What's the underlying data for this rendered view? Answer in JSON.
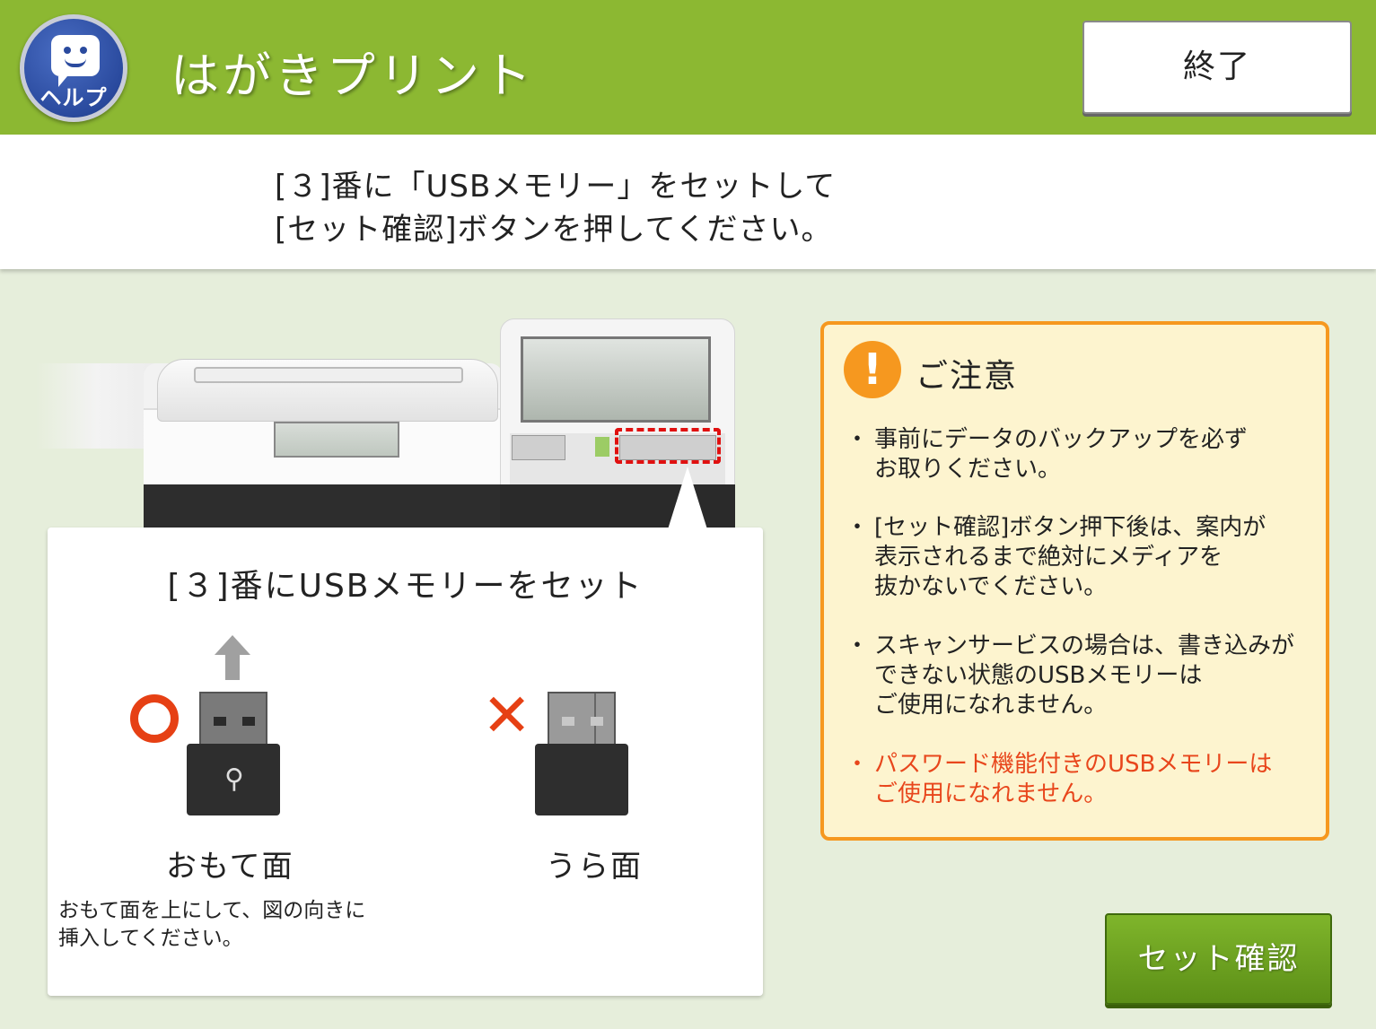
{
  "header": {
    "help_label": "ヘルプ",
    "title": "はがきプリント",
    "end_label": "終了",
    "background_color": "#8cb832"
  },
  "instruction": {
    "line1": "[３]番に「USBメモリー」をセットして",
    "line2": "[セット確認]ボタンを押してください。"
  },
  "illustration": {
    "card_title": "[３]番にUSBメモリーをセット",
    "front_label": "おもて面",
    "back_label": "うら面",
    "note_line1": "おもて面を上にして、図の向きに",
    "note_line2": "挿入してください。",
    "usb_symbol": "⚲",
    "highlight_color": "#e01010"
  },
  "caution": {
    "icon": "!",
    "title": "ご注意",
    "items": [
      {
        "bullet": "・",
        "lines": [
          "事前にデータのバックアップを必ず",
          "お取りください。"
        ]
      },
      {
        "bullet": "・",
        "lines": [
          "[セット確認]ボタン押下後は、案内が",
          "表示されるまで絶対にメディアを",
          "抜かないでください。"
        ]
      },
      {
        "bullet": "・",
        "lines": [
          "スキャンサービスの場合は、書き込みが",
          "できない状態のUSBメモリーは",
          "ご使用になれません。"
        ]
      },
      {
        "bullet": "・",
        "lines": [
          "パスワード機能付きのUSBメモリーは",
          "ご使用になれません。"
        ]
      }
    ],
    "border_color": "#f6981f",
    "warning_color": "#e8461c"
  },
  "confirm_button": {
    "label": "セット確認"
  }
}
